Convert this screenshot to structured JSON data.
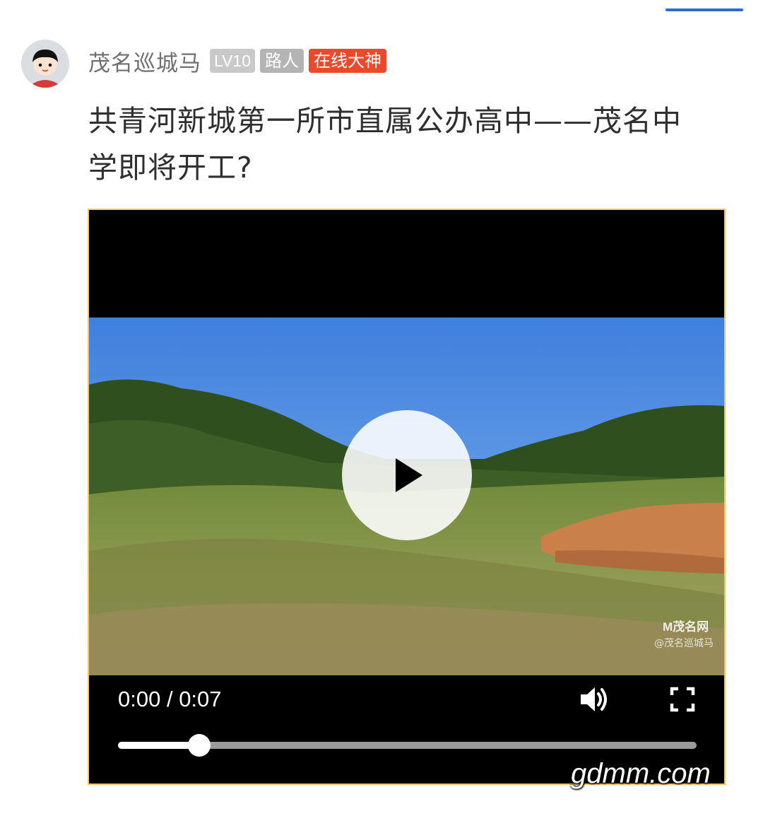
{
  "post": {
    "author": {
      "name": "茂名巡城马",
      "level": "LV10",
      "role": "路人",
      "honor": "在线大神",
      "avatar_icon": "cartoon-boy-avatar-icon"
    },
    "title": "共青河新城第一所市直属公办高中——茂名中学即将开工?"
  },
  "video": {
    "current_time": "0:00",
    "separator": " / ",
    "duration": "0:07",
    "progress": 0.14,
    "watermark_brand": "M茂名网",
    "watermark_user": "@茂名巡城马",
    "icons": {
      "play": "play-icon",
      "volume": "volume-icon",
      "fullscreen": "fullscreen-icon"
    }
  },
  "site_watermark": "gdmm.com",
  "colors": {
    "accent_rule": "#2f6ad6",
    "honor_badge": "#ea4a2b",
    "player_border": "#f2c46a"
  }
}
